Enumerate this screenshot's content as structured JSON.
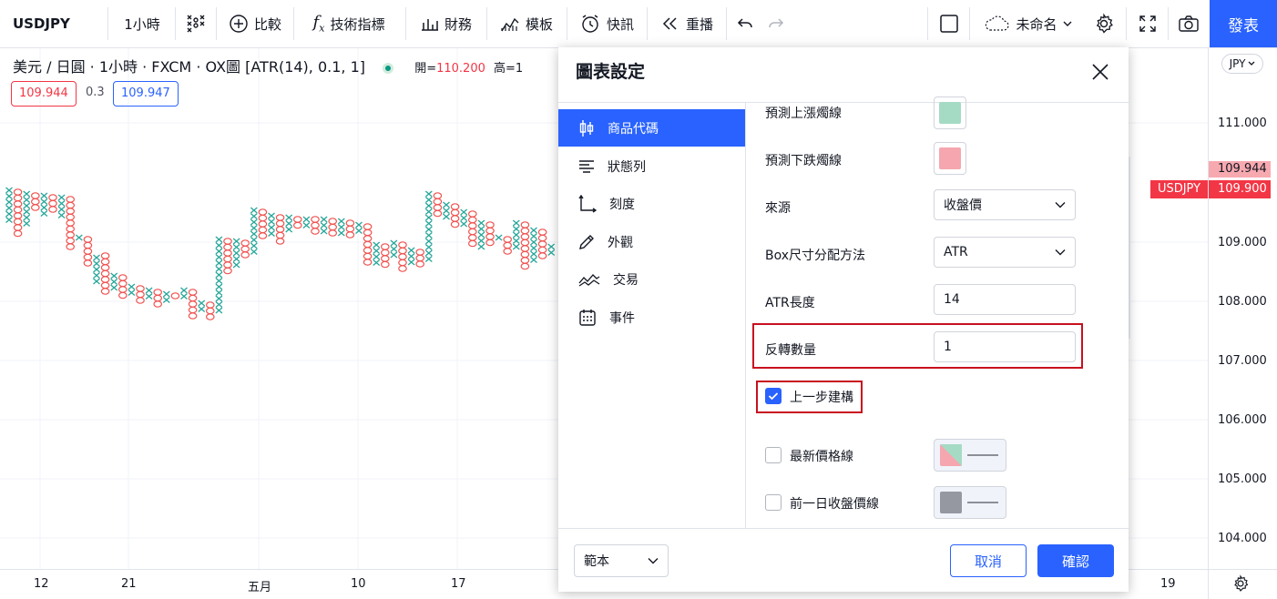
{
  "toolbar": {
    "symbol": "USDJPY",
    "interval": "1小時",
    "compare": "比較",
    "indicators": "技術指標",
    "financials": "財務",
    "templates": "模板",
    "alerts": "快訊",
    "replay": "重播",
    "layout_name": "未命名",
    "publish": "發表"
  },
  "legend": {
    "title": "美元 / 日圓 · 1小時 · FXCM · OX圖 [ATR(14), 0.1, 1]",
    "open_label": "開=",
    "open_value": "110.200",
    "high_label": "高=1",
    "bid": "109.944",
    "spread": "0.3",
    "ask": "109.947"
  },
  "price_axis": {
    "currency": "JPY",
    "labels": [
      "111.000",
      "109.000",
      "108.000",
      "107.000",
      "106.000",
      "105.000",
      "104.000"
    ],
    "tag_bid": "109.944",
    "tag_symbol": "USDJPY",
    "tag_last": "109.900"
  },
  "time_axis": {
    "labels": [
      "12",
      "21",
      "五月",
      "10",
      "17",
      "19"
    ]
  },
  "dialog": {
    "title": "圖表設定",
    "nav": [
      {
        "label": "商品代碼",
        "icon": "candles-icon",
        "active": true
      },
      {
        "label": "狀態列",
        "icon": "status-line-icon",
        "active": false
      },
      {
        "label": "刻度",
        "icon": "scales-icon",
        "active": false
      },
      {
        "label": "外觀",
        "icon": "pencil-icon",
        "active": false
      },
      {
        "label": "交易",
        "icon": "trading-icon",
        "active": false
      },
      {
        "label": "事件",
        "icon": "calendar-icon",
        "active": false
      }
    ],
    "rows": {
      "up_projection": "預測上漲燭線",
      "down_projection": "預測下跌燭線",
      "source_label": "來源",
      "source_value": "收盤價",
      "box_method_label": "Box尺寸分配方法",
      "box_method_value": "ATR",
      "atr_length_label": "ATR長度",
      "atr_length_value": "14",
      "reversal_label": "反轉數量",
      "reversal_value": "1",
      "one_step_label": "上一步建構",
      "last_price_label": "最新價格線",
      "prev_close_label": "前一日收盤價線"
    },
    "colors": {
      "up": "#a5dbc4",
      "down": "#f5a6ae",
      "prev_close": "#9598a1",
      "accent": "#2962ff"
    },
    "template_label": "範本",
    "cancel": "取消",
    "ok": "確認"
  }
}
